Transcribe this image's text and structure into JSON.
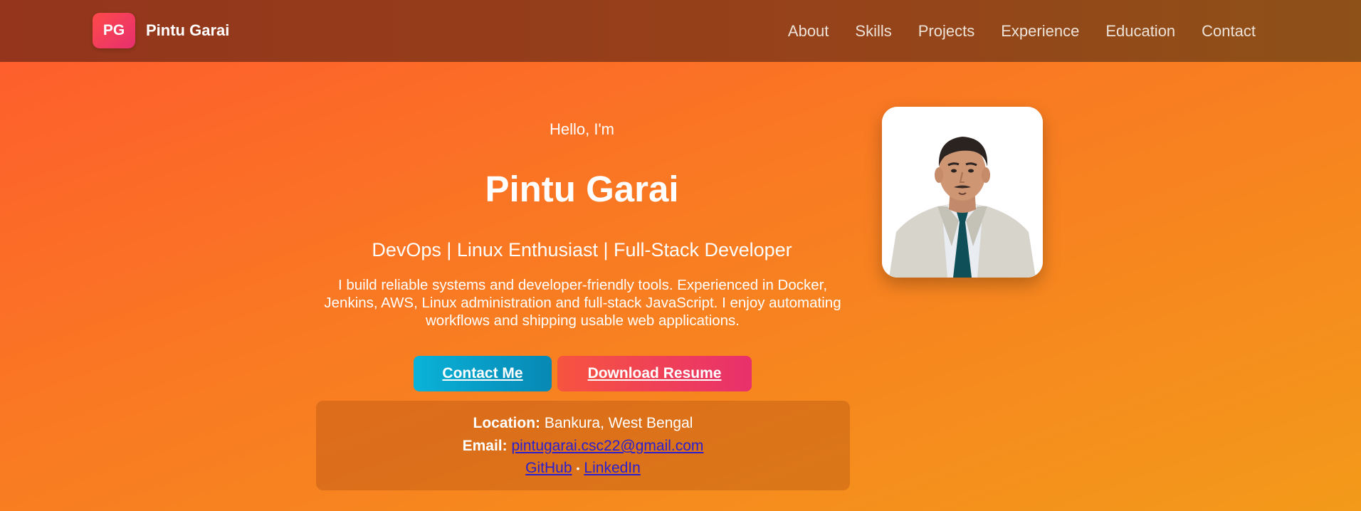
{
  "nav": {
    "logo_initials": "PG",
    "brand_name": "Pintu Garai",
    "links": [
      "About",
      "Skills",
      "Projects",
      "Experience",
      "Education",
      "Contact"
    ]
  },
  "hero": {
    "greeting": "Hello, I'm",
    "name": "Pintu Garai",
    "tagline": "DevOps | Linux Enthusiast | Full-Stack Developer",
    "bio": "I build reliable systems and developer-friendly tools. Experienced in Docker, Jenkins, AWS, Linux administration and full-stack JavaScript. I enjoy automating workflows and shipping usable web applications.",
    "contact_button": "Contact Me",
    "resume_button": "Download Resume"
  },
  "info": {
    "location_label": "Location:",
    "location_value": "Bankura, West Bengal",
    "email_label": "Email:",
    "email_value": "pintugarai.csc22@gmail.com",
    "github_label": "GitHub",
    "linkedin_label": "LinkedIn",
    "separator": "•"
  },
  "colors": {
    "accent_contact": "#0a9fcc",
    "accent_resume": "#ef3f58",
    "link_color": "#2a1fd0"
  }
}
